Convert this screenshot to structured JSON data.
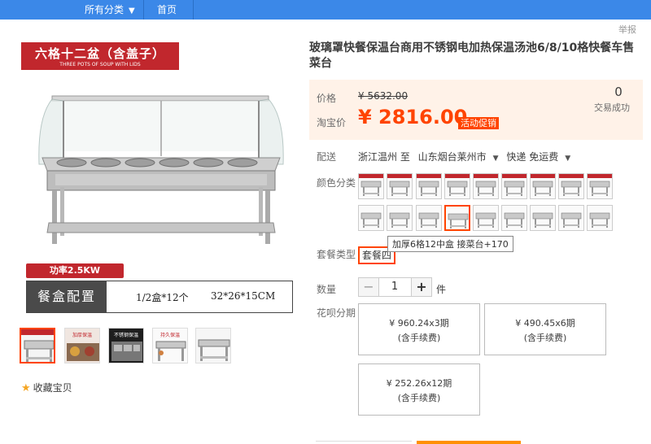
{
  "nav": {
    "category_label": "所有分类",
    "category_arrow": "▼",
    "home_label": "首页"
  },
  "report_label": "举报",
  "gallery": {
    "banner_title": "六格十二盆（含盖子）",
    "banner_subtitle": "THREE POTS OF SOUP WITH LIDS",
    "power_label": "功率2.5KW",
    "spec_label": "餐盒配置",
    "spec_value1": "1/2盒*12个",
    "spec_value2": "32*26*15CM",
    "thumbs": [
      {
        "caption": ""
      },
      {
        "caption": "加厚保温"
      },
      {
        "caption": "不锈钢保温"
      },
      {
        "caption": "持久保温"
      },
      {
        "caption": ""
      }
    ]
  },
  "favorite_label": "收藏宝贝",
  "product": {
    "title": "玻璃罩快餐保温台商用不锈钢电加热保温汤池6/8/10格快餐车售菜台",
    "price_label": "价格",
    "original_price": "¥ 5632.00",
    "taobao_price_label": "淘宝价",
    "current_price": "¥ 2816.00",
    "promo_label": "活动促销",
    "sold_count": "0",
    "sold_label": "交易成功"
  },
  "shipping": {
    "label": "配送",
    "from": "浙江温州 至",
    "to": "山东烟台莱州市",
    "method": "快递 免运费"
  },
  "color": {
    "label": "颜色分类",
    "selected_index": 12
  },
  "package": {
    "label": "套餐类型",
    "selected": "套餐四",
    "tooltip": "加厚6格12中盒 接菜台+170"
  },
  "quantity": {
    "label": "数量",
    "minus": "−",
    "value": "1",
    "plus": "+",
    "unit": "件"
  },
  "installments": {
    "label": "花呗分期",
    "options": [
      {
        "line1": "¥ 960.24x3期",
        "line2": "(含手续费)"
      },
      {
        "line1": "¥ 490.45x6期",
        "line2": "(含手续费)"
      },
      {
        "line1": "¥ 252.26x12期",
        "line2": "(含手续费)"
      }
    ]
  },
  "colors": {
    "accent": "#ff4400",
    "nav_blue": "#3b88e8",
    "banner_red": "#c1272d",
    "price_bg": "#fff2e8"
  }
}
